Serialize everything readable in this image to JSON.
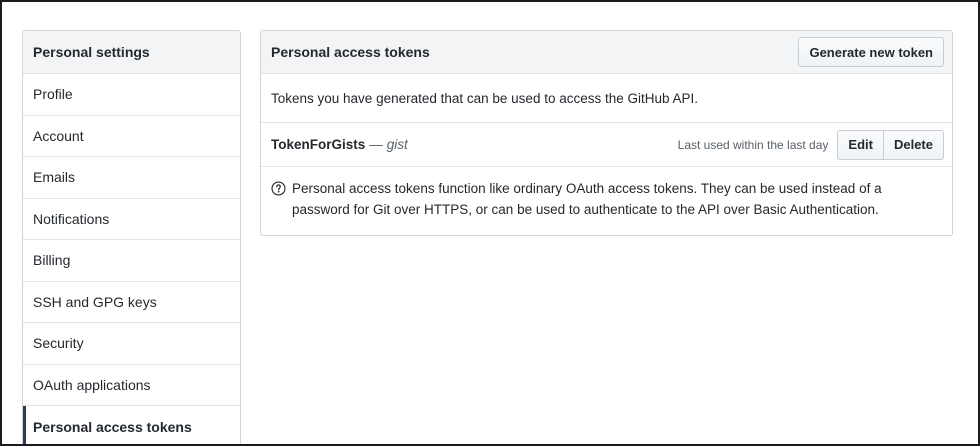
{
  "sidebar": {
    "header": "Personal settings",
    "items": [
      {
        "label": "Profile"
      },
      {
        "label": "Account"
      },
      {
        "label": "Emails"
      },
      {
        "label": "Notifications"
      },
      {
        "label": "Billing"
      },
      {
        "label": "SSH and GPG keys"
      },
      {
        "label": "Security"
      },
      {
        "label": "OAuth applications"
      },
      {
        "label": "Personal access tokens",
        "selected": true
      }
    ]
  },
  "main": {
    "title": "Personal access tokens",
    "generate_button": "Generate new token",
    "description": "Tokens you have generated that can be used to access the GitHub API.",
    "token": {
      "name": "TokenForGists",
      "separator": "—",
      "scope": "gist",
      "last_used": "Last used within the last day",
      "edit_label": "Edit",
      "delete_label": "Delete"
    },
    "note": {
      "icon": "question-circle-icon",
      "text": "Personal access tokens function like ordinary OAuth access tokens. They can be used instead of a password for Git over HTTPS, or can be used to authenticate to the API over Basic Authentication."
    }
  },
  "colors": {
    "header_bg": "#f3f4f6",
    "border": "#d1d5da",
    "selected_indicator": "#2f3b4f",
    "text": "#24292e",
    "muted": "#586069"
  }
}
